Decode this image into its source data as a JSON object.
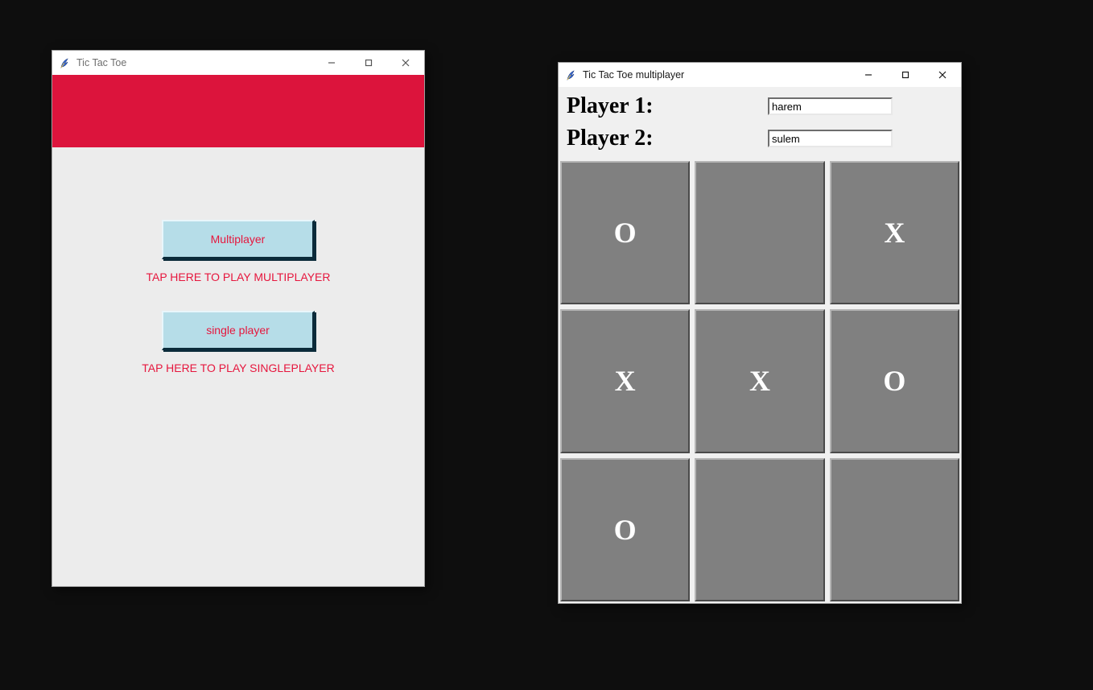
{
  "colors": {
    "accent_red": "#dc143c",
    "button_bg": "#b6dde8",
    "cell_bg": "#808080"
  },
  "menu_window": {
    "title": "Tic Tac Toe",
    "buttons": {
      "multiplayer_label": "Multiplayer",
      "singleplayer_label": "single player"
    },
    "hints": {
      "multiplayer": "TAP HERE TO PLAY MULTIPLAYER",
      "singleplayer": "TAP HERE TO PLAY SINGLEPLAYER"
    }
  },
  "board_window": {
    "title": "Tic Tac Toe multiplayer",
    "player1_label": "Player 1:",
    "player2_label": "Player 2:",
    "player1_value": "harem",
    "player2_value": "sulem",
    "cells": {
      "r0c0": "O",
      "r0c1": "",
      "r0c2": "X",
      "r1c0": "X",
      "r1c1": "X",
      "r1c2": "O",
      "r2c0": "O",
      "r2c1": "",
      "r2c2": ""
    }
  }
}
